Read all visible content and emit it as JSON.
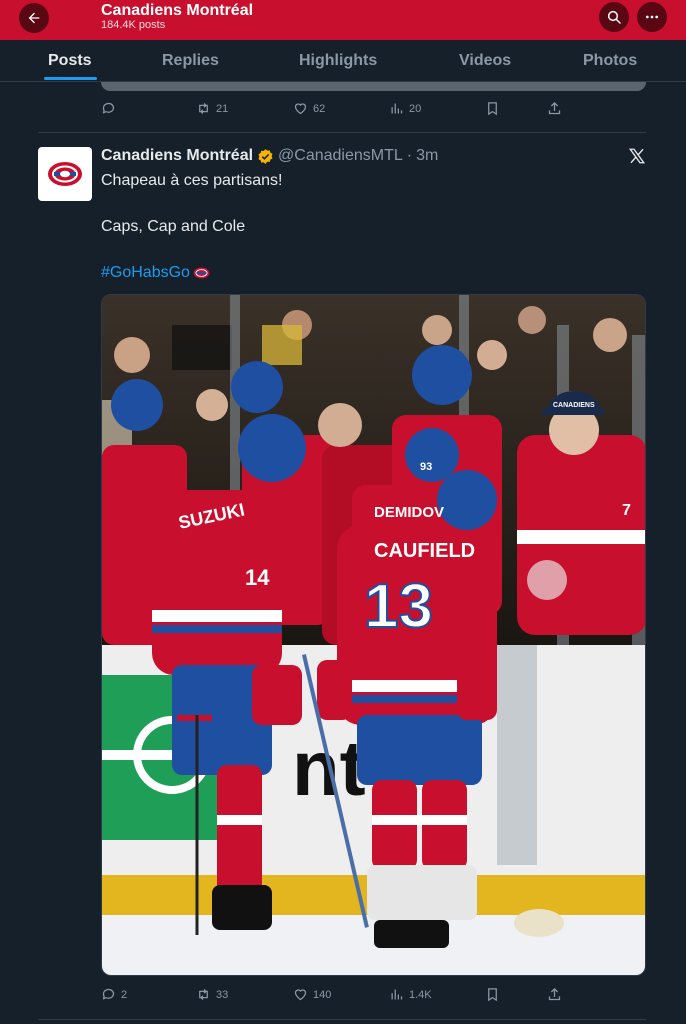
{
  "header": {
    "title": "Canadiens Montréal",
    "subtitle": "184.4K posts",
    "back_icon": "arrow-left-icon",
    "search_icon": "search-icon",
    "more_icon": "more-icon"
  },
  "tabs": [
    {
      "label": "Posts",
      "active": true
    },
    {
      "label": "Replies",
      "active": false
    },
    {
      "label": "Highlights",
      "active": false
    },
    {
      "label": "Videos",
      "active": false
    },
    {
      "label": "Photos",
      "active": false
    }
  ],
  "prev_post": {
    "actions": {
      "replies": "",
      "reposts": "21",
      "likes": "62",
      "views": "20"
    }
  },
  "post": {
    "author_name": "Canadiens Montréal",
    "verified": true,
    "handle": "@CanadiensMTL",
    "separator": "·",
    "time": "3m",
    "text_line1": "Chapeau à ces partisans!",
    "text_line2": "Caps, Cap and Cole",
    "hashtag": "#GoHabsGo",
    "media": {
      "players": [
        {
          "name": "SUZUKI",
          "number": "14"
        },
        {
          "name": "CAUFIELD",
          "number": "13"
        },
        {
          "name": "DEMIDOV",
          "number": "93"
        }
      ],
      "board_text": "nt ri",
      "cap_text": "CANADIENS"
    },
    "actions": {
      "replies": "2",
      "reposts": "33",
      "likes": "140",
      "views": "1.4K"
    }
  },
  "colors": {
    "accent": "#1d9bf0",
    "brand": "#c8102e",
    "background": "#15202b",
    "verified": "#f4b400",
    "jersey_blue": "#1e4fa0"
  }
}
